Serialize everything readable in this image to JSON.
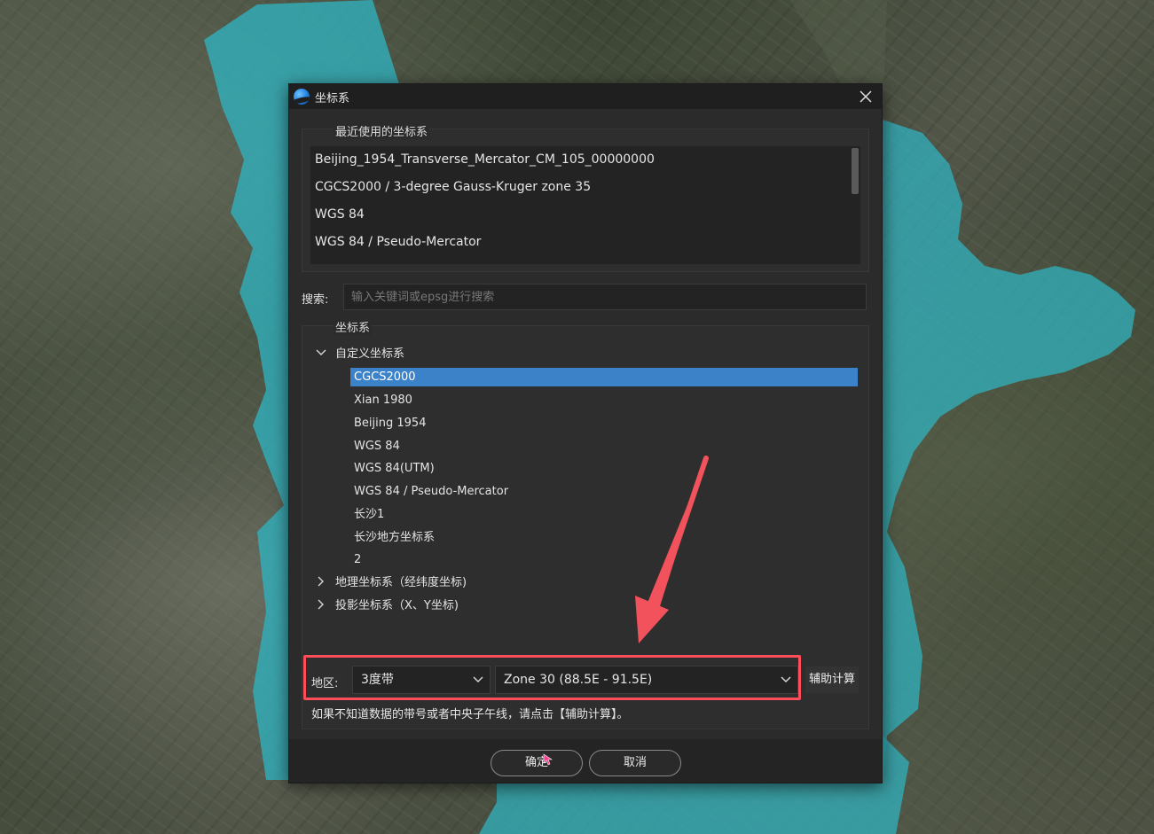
{
  "dialog": {
    "title": "坐标系",
    "recent_group_label": "最近使用的坐标系",
    "recent_items": [
      "Beijing_1954_Transverse_Mercator_CM_105_00000000",
      "CGCS2000 / 3-degree Gauss-Kruger zone 35",
      "WGS 84",
      "WGS 84 / Pseudo-Mercator"
    ],
    "search": {
      "label": "搜索:",
      "placeholder": "输入关键词或epsg进行搜索"
    },
    "tree_group_label": "坐标系",
    "tree": {
      "custom": {
        "label": "自定义坐标系",
        "expanded": true,
        "children": [
          "CGCS2000",
          "Xian 1980",
          "Beijing 1954",
          "WGS 84",
          "WGS 84(UTM)",
          "WGS 84 / Pseudo-Mercator",
          "长沙1",
          "长沙地方坐标系",
          "2"
        ],
        "selected": "CGCS2000"
      },
      "geographic": {
        "label": "地理坐标系（经纬度坐标)",
        "expanded": false
      },
      "projected": {
        "label": "投影坐标系（X、Y坐标)",
        "expanded": false
      }
    },
    "region": {
      "label": "地区:",
      "band_value": "3度带",
      "zone_value": "Zone 30 (88.5E - 91.5E)",
      "aux_button": "辅助计算",
      "hint": "如果不知道数据的带号或者中央子午线，请点击【辅助计算】。"
    },
    "ok_button": "确定",
    "cancel_button": "取消"
  },
  "colors": {
    "selection": "#3c82c9",
    "highlight_frame": "#ff4d5a",
    "annotation_arrow": "#f2525c",
    "water_overlay": "#2fb6c4"
  },
  "icons": {
    "app": "app-logo-icon",
    "close": "close-icon",
    "expanded": "chevron-down-icon",
    "collapsed": "chevron-right-icon",
    "dropdown": "chevron-down-icon",
    "annotation": "arrow-icon"
  }
}
